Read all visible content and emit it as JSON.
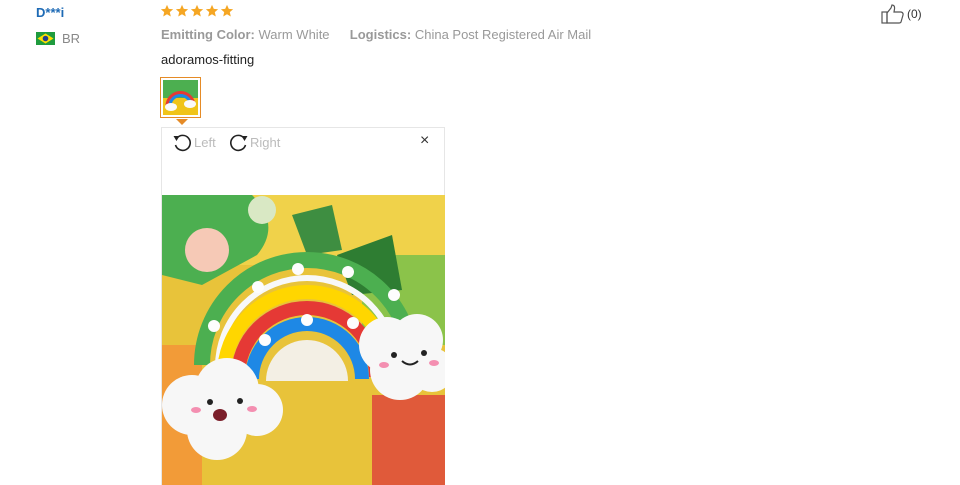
{
  "review": {
    "user_name": "D***i",
    "country_code": "BR",
    "flag_icon": "brazil-flag-icon",
    "rating": 5,
    "rating_max": 5,
    "star_color": "#f5a623",
    "attributes": [
      {
        "key": "Emitting Color:",
        "value": "Warm White"
      },
      {
        "key": "Logistics:",
        "value": "China Post Registered Air Mail"
      }
    ],
    "text": "adoramos-fitting",
    "helpful_count": "(0)",
    "like_icon": "thumbs-up-icon"
  },
  "viewer": {
    "rotate_left_label": "Left",
    "rotate_right_label": "Right",
    "close_label": "×",
    "accent_color": "#e58b27"
  }
}
